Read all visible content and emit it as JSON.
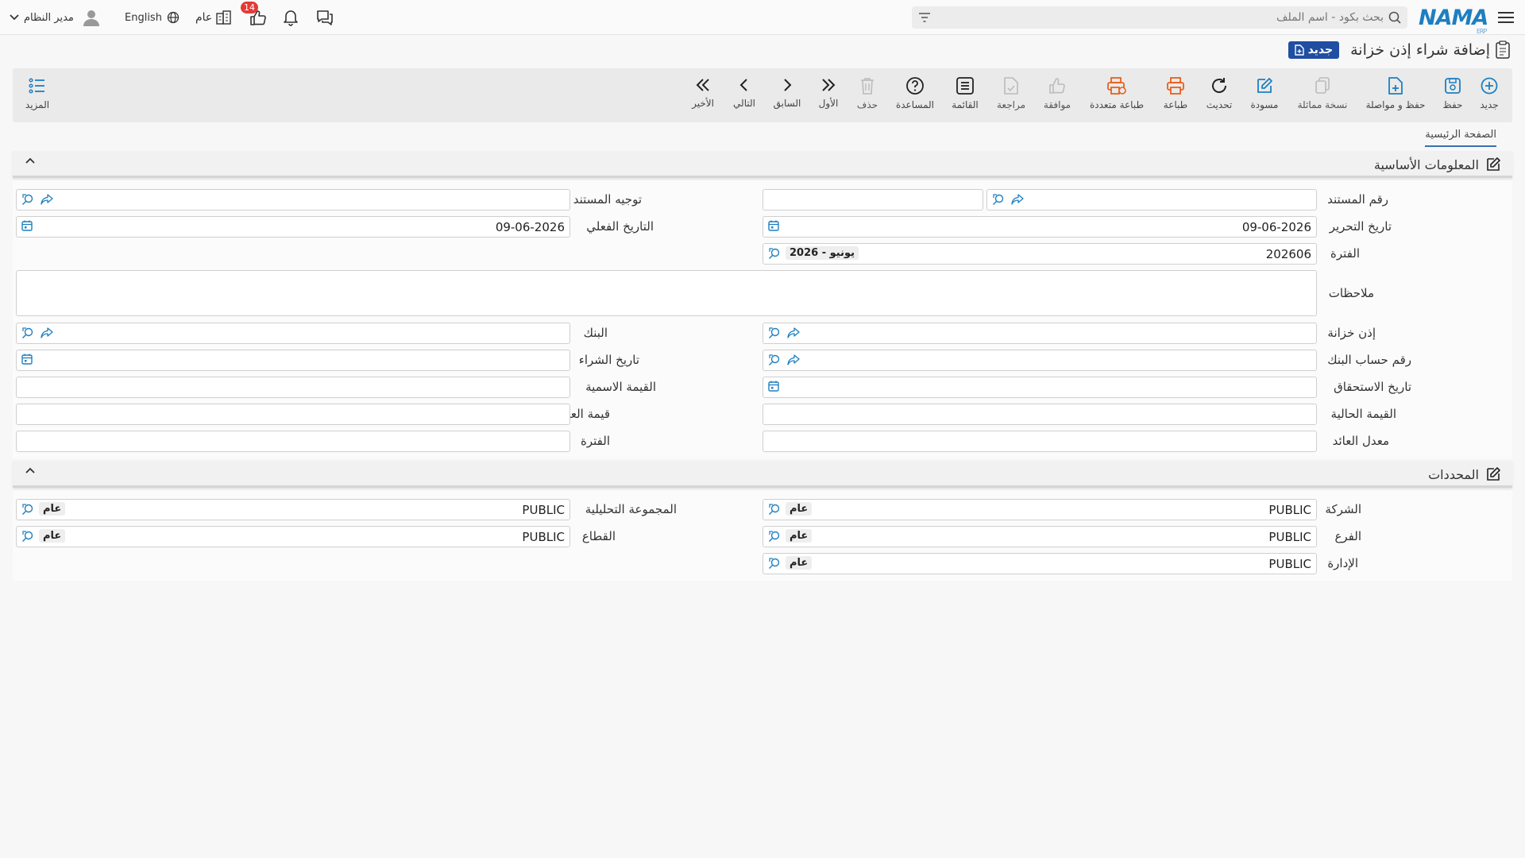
{
  "topbar": {
    "search_placeholder": "بحث بكود - اسم الملف",
    "logo_text": "NAMA",
    "logo_sub": "ERP",
    "notification_count": "14",
    "scope_label": "عام",
    "language_label": "English",
    "user_name": "مدير النظام"
  },
  "page": {
    "title": "إضافة شراء إذن خزانة",
    "status_badge": "جديد"
  },
  "toolbar": {
    "new": "جديد",
    "save": "حفظ",
    "save_continue": "حفظ و مواصلة",
    "duplicate": "نسخة مماثلة",
    "draft": "مسودة",
    "refresh": "تحديث",
    "print": "طباعة",
    "multi_print": "طباعة متعددة",
    "approve": "موافقة",
    "review": "مراجعة",
    "list": "القائمة",
    "help": "المساعدة",
    "delete": "حذف",
    "first": "الأول",
    "previous": "السابق",
    "next": "التالي",
    "last": "الأخير",
    "more": "المزيد"
  },
  "tabs": {
    "main": "الصفحة الرئيسية"
  },
  "basic_info": {
    "title": "المعلومات الأساسية",
    "doc_number_label": "رقم المستند",
    "doc_direction_label": "توجيه المستند",
    "edit_date_label": "تاريخ التحرير",
    "edit_date_value": "09-06-2026",
    "actual_date_label": "التاريخ الفعلي",
    "actual_date_value": "09-06-2026",
    "period_label": "الفترة",
    "period_value": "202606",
    "period_tag": "2026 - يونيو",
    "notes_label": "ملاحظات",
    "treasury_permit_label": "إذن خزانة",
    "bank_label": "البنك",
    "bank_account_label": "رقم حساب البنك",
    "purchase_date_label": "تاريخ الشراء",
    "due_date_label": "تاريخ الاستحقاق",
    "nominal_value_label": "القيمة الاسمية",
    "present_value_label": "القيمة الحالية",
    "yield_value_label": "قيمة العائد",
    "yield_rate_label": "معدل العائد",
    "term_label": "الفترة"
  },
  "dimensions": {
    "title": "المحددات",
    "company_label": "الشركة",
    "company_value": "PUBLIC",
    "company_tag": "عام",
    "analytic_group_label": "المجموعة التحليلية",
    "analytic_group_value": "PUBLIC",
    "analytic_group_tag": "عام",
    "branch_label": "الفرع",
    "branch_value": "PUBLIC",
    "branch_tag": "عام",
    "sector_label": "القطاع",
    "sector_value": "PUBLIC",
    "sector_tag": "عام",
    "department_label": "الإدارة",
    "department_value": "PUBLIC",
    "department_tag": "عام"
  },
  "colors": {
    "accent_blue": "#1e7fc0",
    "print_orange": "#e8601c",
    "badge_red": "#e53935",
    "status_badge_bg": "#1f4ea3"
  }
}
